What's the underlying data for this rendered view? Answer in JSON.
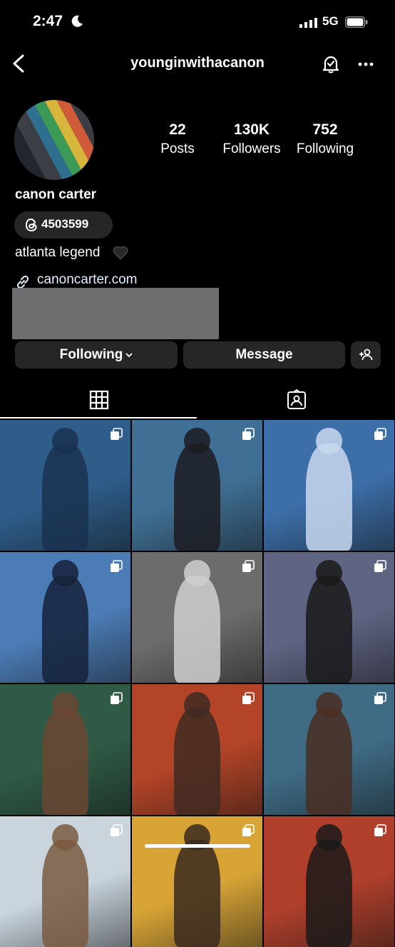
{
  "status_bar": {
    "time": "2:47",
    "network": "5G"
  },
  "header": {
    "username": "younginwithacanon"
  },
  "profile": {
    "stats": [
      {
        "value": "22",
        "label": "Posts"
      },
      {
        "value": "130K",
        "label": "Followers"
      },
      {
        "value": "752",
        "label": "Following"
      }
    ],
    "display_name": "canon carter",
    "threads_count": "4503599",
    "bio": "atlanta legend",
    "link": "canoncarter.com"
  },
  "actions": {
    "following_label": "Following",
    "message_label": "Message"
  },
  "colors": {
    "background": "#000000",
    "button": "#262626",
    "link": "#e0f1ff",
    "redaction": "#6e6e70"
  },
  "grid_posts": [
    {
      "bg": "#2e5d8a",
      "accent": "#1a3150",
      "multi": true
    },
    {
      "bg": "#3f6f94",
      "accent": "#1c1c22",
      "multi": true
    },
    {
      "bg": "#3c6ea8",
      "accent": "#c9d8ee",
      "multi": true
    },
    {
      "bg": "#4b7cb6",
      "accent": "#15223a",
      "multi": true
    },
    {
      "bg": "#6c6c6c",
      "accent": "#cfcfcf",
      "multi": true
    },
    {
      "bg": "#5f6483",
      "accent": "#1a1a1a",
      "multi": true
    },
    {
      "bg": "#2f5a45",
      "accent": "#6b4634",
      "multi": true
    },
    {
      "bg": "#b34427",
      "accent": "#3f2a22",
      "multi": true
    },
    {
      "bg": "#3f6b85",
      "accent": "#4a2e22",
      "multi": true
    },
    {
      "bg": "#c9d4dd",
      "accent": "#7a5a40",
      "multi": true
    },
    {
      "bg": "#d8a436",
      "accent": "#3a2a1e",
      "multi": true
    },
    {
      "bg": "#b0402c",
      "accent": "#1a1a1a",
      "multi": true
    }
  ]
}
